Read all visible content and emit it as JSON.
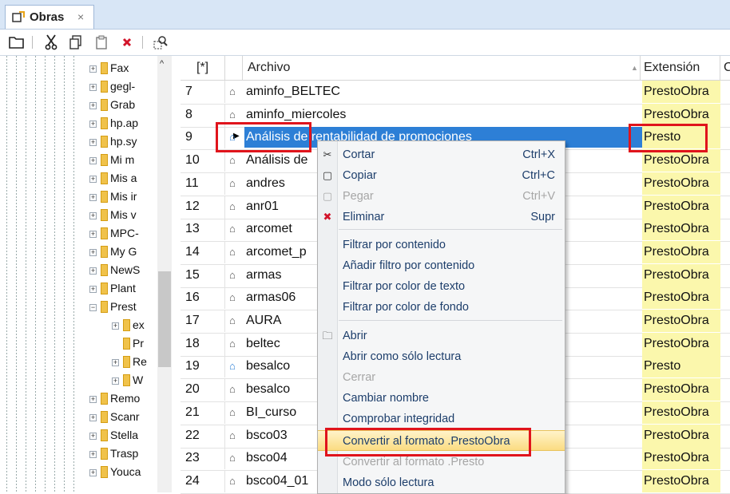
{
  "tab": {
    "label": "Obras",
    "close": "×"
  },
  "toolbar": {
    "icons": [
      "folder-icon",
      "scissors-icon",
      "copy-icon",
      "paste-icon",
      "delete-icon",
      "properties-icon"
    ]
  },
  "tree": {
    "items": [
      {
        "label": "Fax",
        "expander": "+"
      },
      {
        "label": "gegl-",
        "expander": "+"
      },
      {
        "label": "Grab",
        "expander": "+"
      },
      {
        "label": "hp.ap",
        "expander": "+"
      },
      {
        "label": "hp.sy",
        "expander": "+"
      },
      {
        "label": "Mi m",
        "expander": "+"
      },
      {
        "label": "Mis a",
        "expander": "+"
      },
      {
        "label": "Mis ir",
        "expander": "+"
      },
      {
        "label": "Mis v",
        "expander": "+"
      },
      {
        "label": "MPC-",
        "expander": "+"
      },
      {
        "label": "My G",
        "expander": "+"
      },
      {
        "label": "NewS",
        "expander": "+"
      },
      {
        "label": "Plant",
        "expander": "+"
      },
      {
        "label": "Prest",
        "expander": "−"
      },
      {
        "label": "ex",
        "expander": "+"
      },
      {
        "label": "Pr",
        "expander": ""
      },
      {
        "label": "Re",
        "expander": "+"
      },
      {
        "label": "W",
        "expander": "+"
      },
      {
        "label": "Remo",
        "expander": "+"
      },
      {
        "label": "Scanr",
        "expander": "+"
      },
      {
        "label": "Stella",
        "expander": "+"
      },
      {
        "label": "Trasp",
        "expander": "+"
      },
      {
        "label": "Youca",
        "expander": "+"
      }
    ],
    "scroll_up": "^"
  },
  "grid": {
    "headers": {
      "star": "[*]",
      "archivo": "Archivo",
      "extension": "Extensión",
      "next": "C"
    },
    "rows": [
      {
        "num": "7",
        "name": "aminfo_BELTEC",
        "ext": "PrestoObra"
      },
      {
        "num": "8",
        "name": "aminfo_miercoles",
        "ext": "PrestoObra"
      },
      {
        "num": "9",
        "name": "Análisis de rentabilidad de promociones",
        "ext": "Presto"
      },
      {
        "num": "10",
        "name": "Análisis de",
        "ext": "PrestoObra"
      },
      {
        "num": "11",
        "name": "andres",
        "ext": "PrestoObra"
      },
      {
        "num": "12",
        "name": "anr01",
        "ext": "PrestoObra"
      },
      {
        "num": "13",
        "name": "arcomet",
        "ext": "PrestoObra"
      },
      {
        "num": "14",
        "name": "arcomet_p",
        "ext": "PrestoObra"
      },
      {
        "num": "15",
        "name": "armas",
        "ext": "PrestoObra"
      },
      {
        "num": "16",
        "name": "armas06",
        "ext": "PrestoObra"
      },
      {
        "num": "17",
        "name": "AURA",
        "ext": "PrestoObra"
      },
      {
        "num": "18",
        "name": "beltec",
        "ext": "PrestoObra"
      },
      {
        "num": "19",
        "name": "besalco",
        "ext": "Presto"
      },
      {
        "num": "20",
        "name": "besalco",
        "ext": "PrestoObra"
      },
      {
        "num": "21",
        "name": "BI_curso",
        "ext": "PrestoObra"
      },
      {
        "num": "22",
        "name": "bsco03",
        "ext": "PrestoObra"
      },
      {
        "num": "23",
        "name": "bsco04",
        "ext": "PrestoObra"
      },
      {
        "num": "24",
        "name": "bsco04_01",
        "ext": "PrestoObra"
      }
    ]
  },
  "menu": {
    "items": [
      {
        "label": "Cortar",
        "shortcut": "Ctrl+X",
        "icon": "✂",
        "disabled": false
      },
      {
        "label": "Copiar",
        "shortcut": "Ctrl+C",
        "icon": "▢",
        "disabled": false
      },
      {
        "label": "Pegar",
        "shortcut": "Ctrl+V",
        "icon": "▢",
        "disabled": true
      },
      {
        "label": "Eliminar",
        "shortcut": "Supr",
        "icon": "✖",
        "disabled": false
      },
      {
        "label": "Filtrar por contenido",
        "shortcut": "",
        "icon": "",
        "disabled": false
      },
      {
        "label": "Añadir filtro por contenido",
        "shortcut": "",
        "icon": "",
        "disabled": false
      },
      {
        "label": "Filtrar por color de texto",
        "shortcut": "",
        "icon": "",
        "disabled": false
      },
      {
        "label": "Filtrar por color de fondo",
        "shortcut": "",
        "icon": "",
        "disabled": false
      },
      {
        "label": "Abrir",
        "shortcut": "",
        "icon": "🗀",
        "disabled": false
      },
      {
        "label": "Abrir como sólo lectura",
        "shortcut": "",
        "icon": "",
        "disabled": false
      },
      {
        "label": "Cerrar",
        "shortcut": "",
        "icon": "",
        "disabled": true
      },
      {
        "label": "Cambiar nombre",
        "shortcut": "",
        "icon": "",
        "disabled": false
      },
      {
        "label": "Comprobar integridad",
        "shortcut": "",
        "icon": "",
        "disabled": false
      },
      {
        "label": "Convertir al formato .PrestoObra",
        "shortcut": "",
        "icon": "",
        "disabled": false
      },
      {
        "label": "Convertir al formato .Presto",
        "shortcut": "",
        "icon": "",
        "disabled": true
      },
      {
        "label": "Modo sólo lectura",
        "shortcut": "",
        "icon": "",
        "disabled": false
      }
    ]
  },
  "colors": {
    "selection": "#2d7fd6",
    "extension_bg": "#fbf7ac",
    "highlight_box": "#e0141c",
    "menu_hover": "#fbdc82"
  }
}
